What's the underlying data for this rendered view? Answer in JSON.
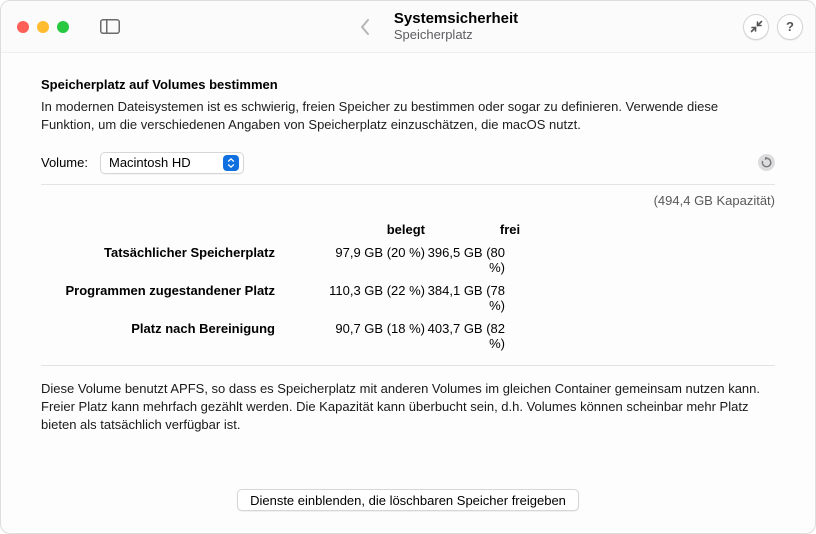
{
  "header": {
    "title": "Systemsicherheit",
    "subtitle": "Speicherplatz"
  },
  "section": {
    "title": "Speicherplatz auf Volumes bestimmen",
    "description": "In modernen Dateisystemen ist es schwierig, freien Speicher zu bestimmen oder sogar zu definieren. Verwende diese Funktion, um die verschiedenen Angaben von Speicherplatz einzuschätzen, die macOS nutzt."
  },
  "volume": {
    "field_label": "Volume:",
    "selected": "Macintosh HD"
  },
  "capacity": "(494,4 GB Kapazität)",
  "table": {
    "headers": {
      "used": "belegt",
      "free": "frei"
    },
    "rows": [
      {
        "label": "Tatsächlicher Speicherplatz",
        "used": "97,9 GB (20 %)",
        "free": "396,5 GB (80 %)"
      },
      {
        "label": "Programmen zugestandener Platz",
        "used": "110,3 GB (22 %)",
        "free": "384,1 GB (78 %)"
      },
      {
        "label": "Platz nach Bereinigung",
        "used": "90,7 GB (18 %)",
        "free": "403,7 GB (82 %)"
      }
    ]
  },
  "note": "Diese Volume benutzt APFS, so dass es Speicherplatz mit anderen Volumes im gleichen Container gemeinsam nutzen kann. Freier Platz kann mehrfach gezählt werden. Die Kapazität kann überbucht sein, d.h. Volumes können scheinbar mehr Platz bieten als tatsächlich verfügbar ist.",
  "footer": {
    "button": "Dienste einblenden, die löschbaren Speicher freigeben"
  }
}
